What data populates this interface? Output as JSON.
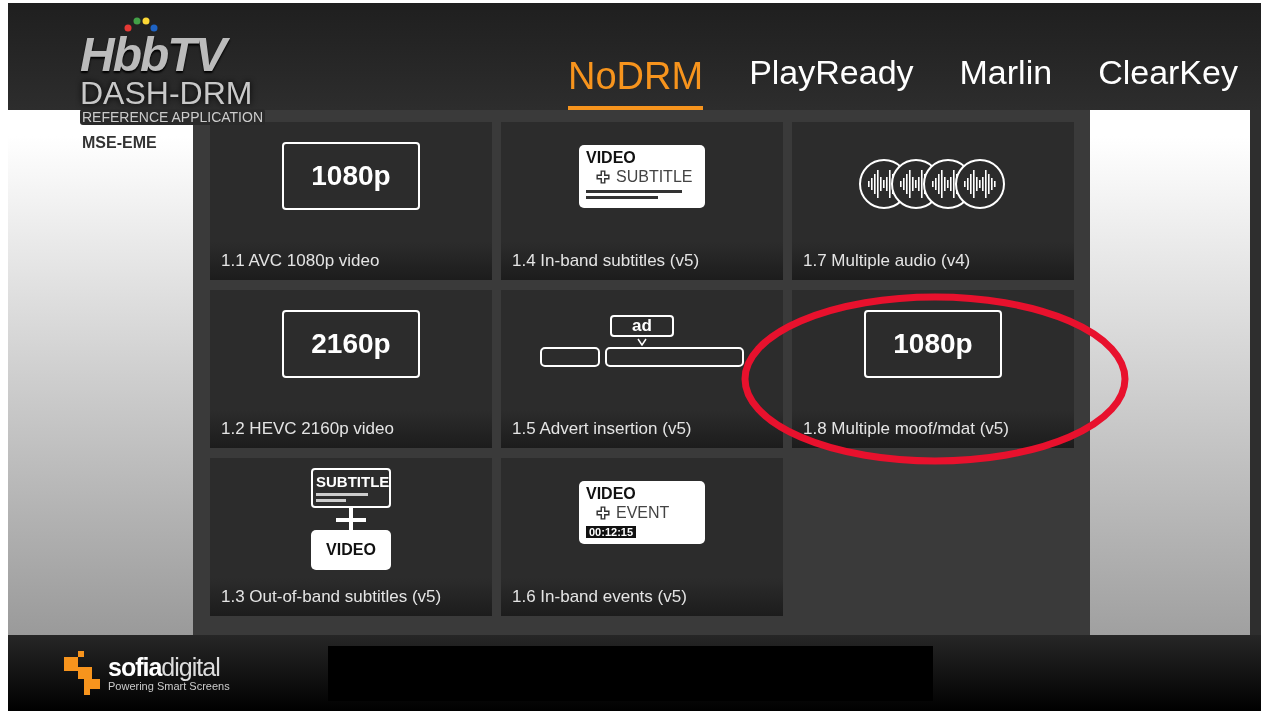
{
  "logo": {
    "name": "HbbTV",
    "subtitle": "DASH-DRM",
    "tagline": "REFERENCE APPLICATION",
    "mode": "MSE-EME"
  },
  "tabs": [
    {
      "label": "NoDRM",
      "selected": true
    },
    {
      "label": "PlayReady",
      "selected": false
    },
    {
      "label": "Marlin",
      "selected": false
    },
    {
      "label": "ClearKey",
      "selected": false
    }
  ],
  "tiles": [
    {
      "kind": "resolution",
      "icon_texts": [
        "1080p"
      ],
      "caption": "1.1 AVC 1080p video",
      "circled": false
    },
    {
      "kind": "video-subtitle",
      "icon_texts": [
        "VIDEO",
        "SUBTITLE"
      ],
      "caption": "1.4 In-band subtitles (v5)",
      "circled": false
    },
    {
      "kind": "audio",
      "caption": "1.7 Multiple audio (v4)",
      "circled": false
    },
    {
      "kind": "resolution",
      "icon_texts": [
        "2160p"
      ],
      "caption": "1.2 HEVC 2160p video",
      "circled": false
    },
    {
      "kind": "advert",
      "icon_texts": [
        "ad"
      ],
      "caption": "1.5 Advert insertion (v5)",
      "circled": false
    },
    {
      "kind": "resolution",
      "icon_texts": [
        "1080p"
      ],
      "caption": "1.8 Multiple moof/mdat (v5)",
      "circled": true
    },
    {
      "kind": "subtitle-video",
      "icon_texts": [
        "SUBTITLE",
        "VIDEO"
      ],
      "caption": "1.3 Out-of-band subtitles (v5)",
      "circled": false
    },
    {
      "kind": "video-event",
      "icon_texts": [
        "VIDEO",
        "EVENT",
        "00:12:15"
      ],
      "caption": "1.6 In-band events (v5)",
      "circled": false
    }
  ],
  "footer": {
    "brand": "**sofia**digital",
    "slogan": "Powering Smart Screens"
  }
}
